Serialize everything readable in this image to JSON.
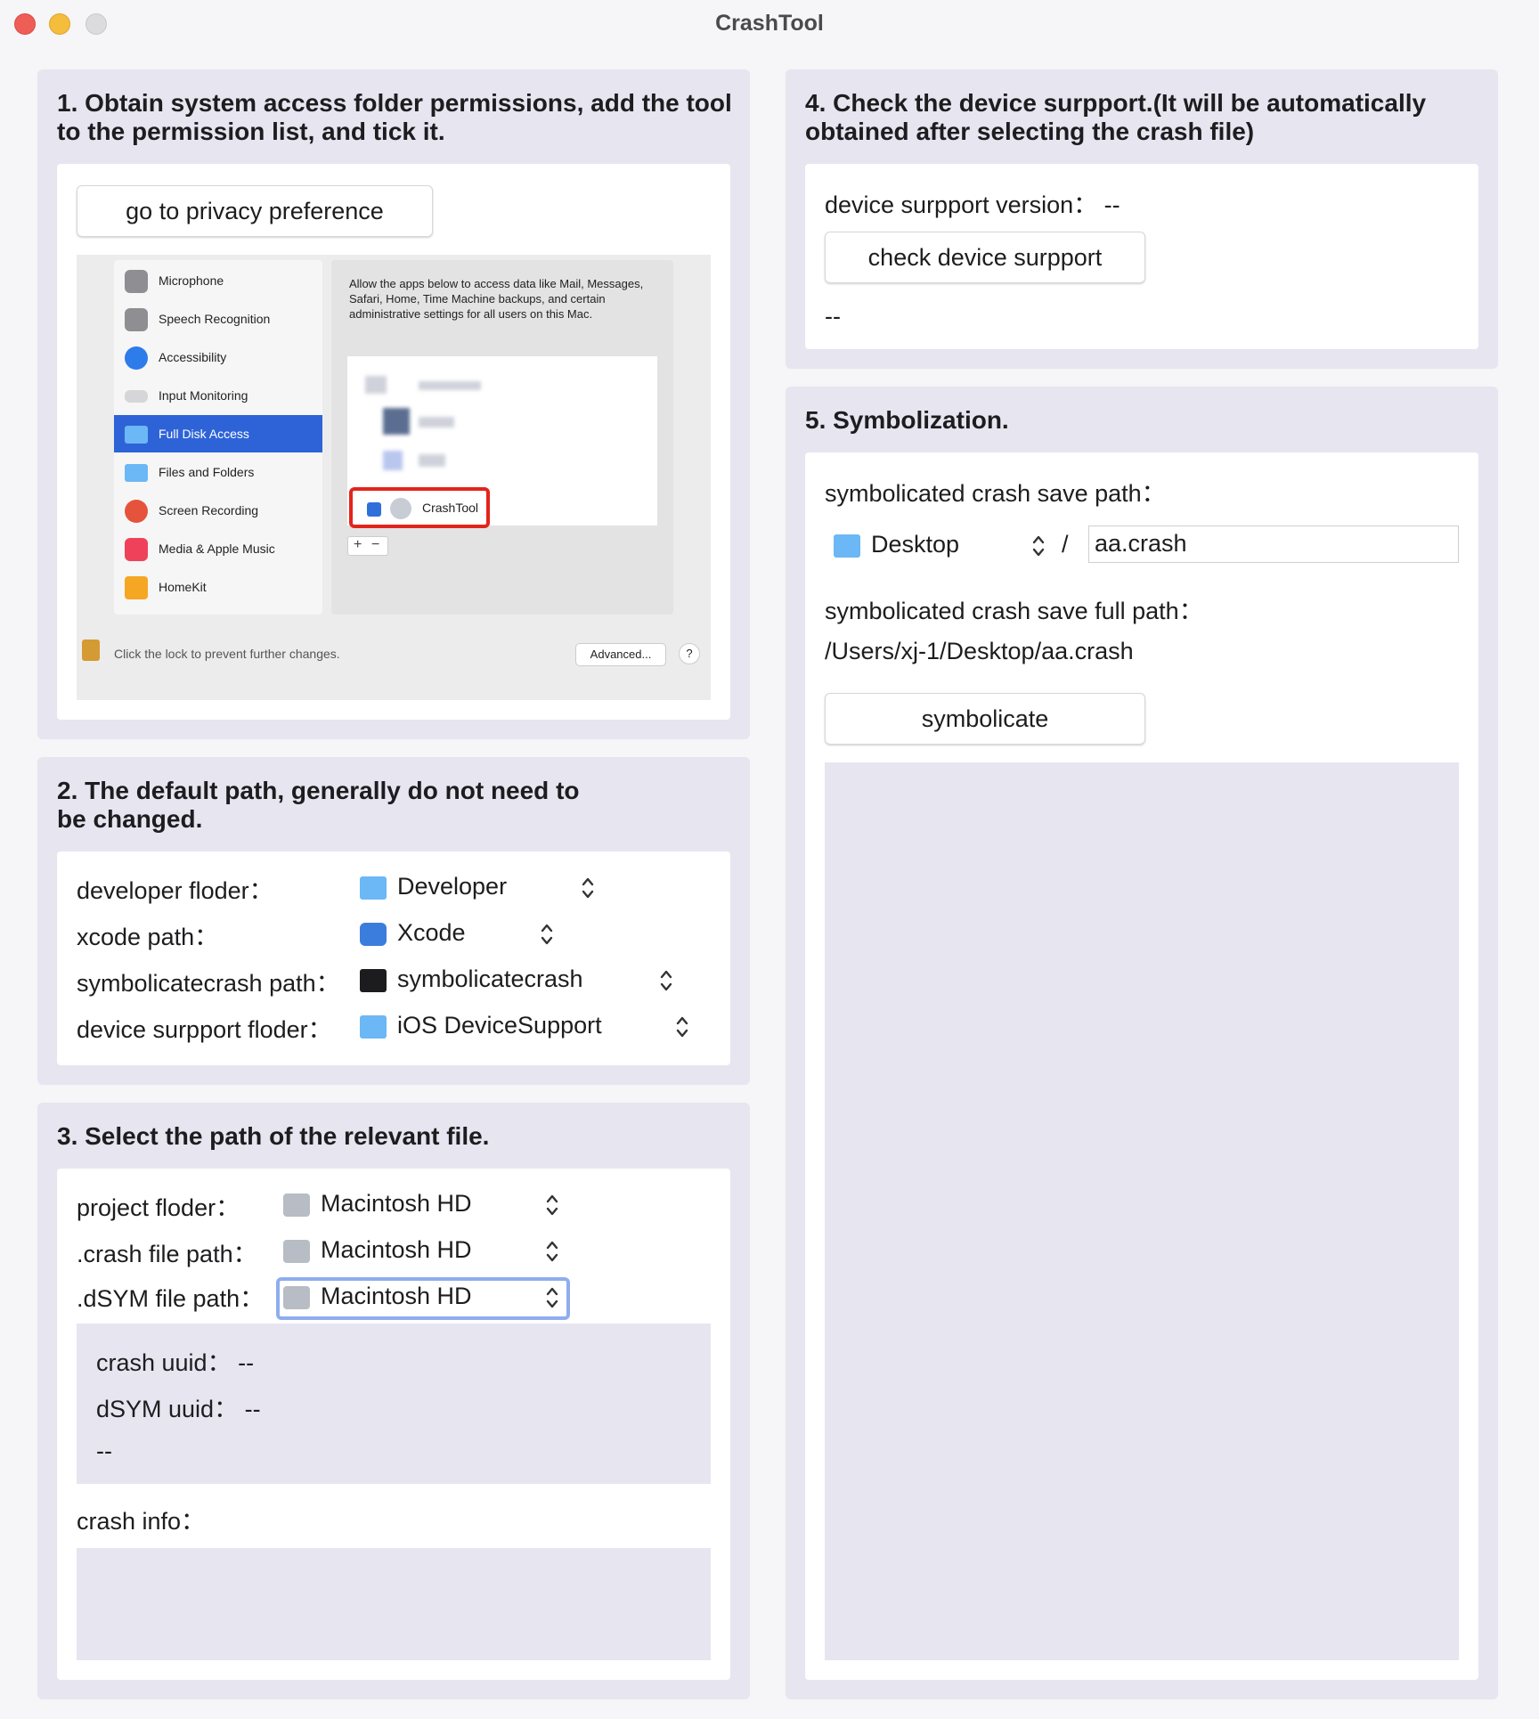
{
  "window": {
    "title": "CrashTool"
  },
  "section1": {
    "heading_line1": "1. Obtain system access folder permissions, add the tool",
    "heading_line2": "to the permission list, and tick it.",
    "button": "go to privacy preference",
    "screenshot": {
      "sidebar": [
        "Microphone",
        "Speech Recognition",
        "Accessibility",
        "Input Monitoring",
        "Full Disk Access",
        "Files and Folders",
        "Screen Recording",
        "Media & Apple Music",
        "HomeKit"
      ],
      "selected": "Full Disk Access",
      "description": "Allow the apps below to access data like Mail, Messages, Safari, Home, Time Machine backups, and certain administrative settings for all users on this Mac.",
      "app": "CrashTool",
      "footer_text": "Click the lock to prevent further changes.",
      "advanced_button": "Advanced...",
      "help_button": "?",
      "plus": "+",
      "minus": "−"
    }
  },
  "section2": {
    "heading_line1": "2. The default path, generally do not need to",
    "heading_line2": "be changed.",
    "rows": [
      {
        "label": "developer floder：",
        "value": "Developer",
        "icon": "folder-icon"
      },
      {
        "label": "xcode path：",
        "value": "Xcode",
        "icon": "xcode-icon"
      },
      {
        "label": "symbolicatecrash path：",
        "value": "symbolicatecrash",
        "icon": "terminal-icon"
      },
      {
        "label": "device surpport floder：",
        "value": "iOS DeviceSupport",
        "icon": "folder-icon"
      }
    ]
  },
  "section3": {
    "heading": "3. Select the path of the relevant file.",
    "rows": [
      {
        "label": "project floder：",
        "value": "Macintosh HD",
        "icon": "disk-icon"
      },
      {
        "label": ".crash file path：",
        "value": "Macintosh HD",
        "icon": "disk-icon"
      },
      {
        "label": ".dSYM file path：",
        "value": "Macintosh HD",
        "icon": "disk-icon"
      }
    ],
    "crash_uuid": "crash uuid： --",
    "dsym_uuid": "dSYM uuid： --",
    "uuid_result": "--",
    "crash_info_label": "crash info："
  },
  "section4": {
    "heading_line1": "4. Check the device surpport.(It will be automatically",
    "heading_line2": "obtained after selecting the crash file)",
    "version": "device surpport version： --",
    "button": "check device surpport",
    "result": "--"
  },
  "section5": {
    "heading": "5. Symbolization.",
    "save_path_label": "symbolicated crash save path：",
    "folder": "Desktop",
    "separator": "/",
    "filename": "aa.crash",
    "full_path_label": "symbolicated crash save full path：",
    "full_path": "/Users/xj-1/Desktop/aa.crash",
    "button": "symbolicate"
  }
}
